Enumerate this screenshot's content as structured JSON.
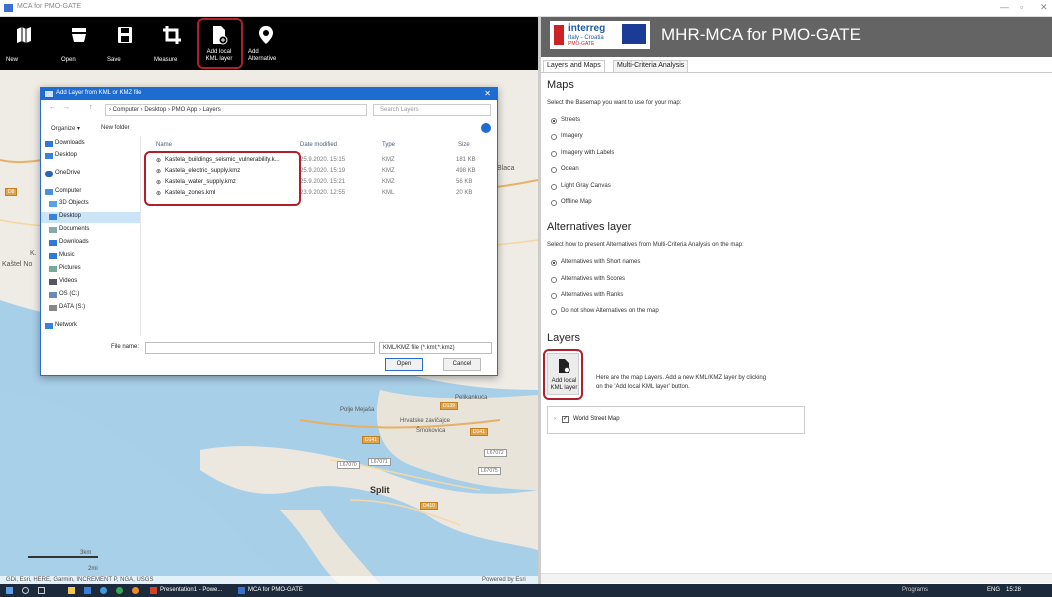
{
  "window": {
    "title": "MCA for PMO-GATE",
    "controls": [
      "—",
      "▫",
      "✕"
    ]
  },
  "toolbar": {
    "buttons": [
      {
        "label": "New",
        "icon": "new-map-icon"
      },
      {
        "label": "Open",
        "icon": "open-icon"
      },
      {
        "label": "Save",
        "icon": "save-icon"
      },
      {
        "label": "Measure",
        "icon": "crop-icon"
      },
      {
        "label": "Add local KML layer",
        "icon": "add-file-icon"
      },
      {
        "label": "Add Alternative",
        "icon": "pin-icon"
      }
    ]
  },
  "map": {
    "labels": [
      "Blaca",
      "Kaštel No",
      "K.",
      "Split",
      "Polje Mejaša",
      "Pelikankuća",
      "Hrvatske zavičajce",
      "Šmokovica"
    ],
    "roads": [
      "D8",
      "D410",
      "D139",
      "D141",
      "D141"
    ],
    "road_white": [
      "L67071",
      "L67070",
      "L67072",
      "L67075"
    ],
    "scale": {
      "top": "3km",
      "bottom": "2mi"
    },
    "attribution": "GDi, Esri, HERE, Garmin, INCREMENT P, NGA, USGS",
    "powered": "Powered by Esri"
  },
  "dialog": {
    "title": "Add Layer from KML or KMZ file",
    "close": "✕",
    "nav": [
      "←",
      "→",
      "↑"
    ],
    "address": "› Computer › Desktop › PMO App › Layers",
    "search_placeholder": "Search Layers",
    "organize": "Organize ▾",
    "new_folder": "New folder",
    "nav_items": [
      "Downloads",
      "Desktop",
      "OneDrive",
      "Computer",
      "3D Objects",
      "Desktop",
      "Documents",
      "Downloads",
      "Music",
      "Pictures",
      "Videos",
      "OS (C:)",
      "DATA (S:)",
      "Network"
    ],
    "columns": [
      "Name",
      "Date modified",
      "Type",
      "Size"
    ],
    "files": [
      {
        "name": "Kastela_buildings_seismic_vulnerability.k...",
        "date": "25.9.2020. 15:15",
        "type": "KMZ",
        "size": "181 KB"
      },
      {
        "name": "Kastela_electric_supply.kmz",
        "date": "25.9.2020. 15:19",
        "type": "KMZ",
        "size": "498 KB"
      },
      {
        "name": "Kastela_water_supply.kmz",
        "date": "25.9.2020. 15:21",
        "type": "KMZ",
        "size": "56 KB"
      },
      {
        "name": "Kastela_zones.kml",
        "date": "23.9.2020. 12:55",
        "type": "KML",
        "size": "20 KB"
      }
    ],
    "file_name_label": "File name:",
    "filter": "KML/KMZ file (*.kml;*.kmz)",
    "open": "Open",
    "cancel": "Cancel"
  },
  "right": {
    "logo": {
      "brand": "interreg",
      "line1": "Italy - Croatia",
      "line2": "PMO-GATE"
    },
    "title": "MHR-MCA for PMO-GATE",
    "tabs": [
      "Layers and Maps",
      "Multi-Criteria Analysis"
    ],
    "maps_heading": "Maps",
    "maps_text": "Select the Basemap you want to use for your map:",
    "basemaps": [
      {
        "label": "Streets",
        "selected": true
      },
      {
        "label": "Imagery",
        "selected": false
      },
      {
        "label": "Imagery with Labels",
        "selected": false
      },
      {
        "label": "Ocean",
        "selected": false
      },
      {
        "label": "Light Gray Canvas",
        "selected": false
      },
      {
        "label": "Offline Map",
        "selected": false
      }
    ],
    "alt_heading": "Alternatives layer",
    "alt_text": "Select how to present Alternatives from Multi-Criteria Analysis on the map:",
    "alt_options": [
      {
        "label": "Alternatives with Short names",
        "selected": true
      },
      {
        "label": "Alternatives with Scores",
        "selected": false
      },
      {
        "label": "Alternatives with Ranks",
        "selected": false
      },
      {
        "label": "Do not show Alternatives on the map",
        "selected": false
      }
    ],
    "layers_heading": "Layers",
    "add_button": "Add local KML layer",
    "layers_text1": "Here are the map Layers. Add a new KML/KMZ layer by clicking",
    "layers_text2": "on the 'Add local KML layer' button.",
    "layer_item": "World Street Map"
  },
  "taskbar": {
    "items": [
      "Presentation1 - Powe...",
      "MCA for PMO-GATE"
    ],
    "tray": "Programs",
    "lang": "ENG",
    "time": "15:28"
  },
  "colors": {
    "highlight": "#b0202a",
    "toolbar": "#000000",
    "header": "#646464",
    "dialog_title": "#1f6cd1"
  }
}
